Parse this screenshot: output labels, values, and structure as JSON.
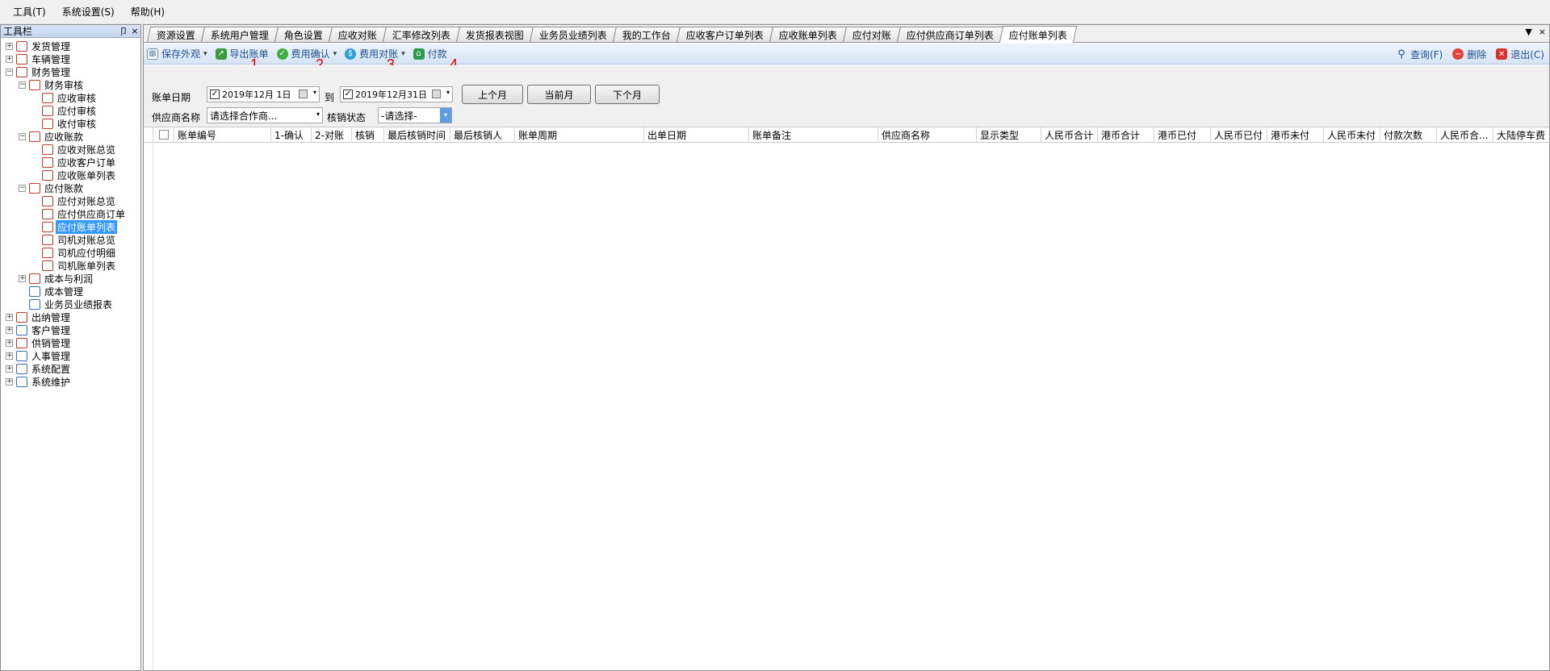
{
  "menu": [
    "工具(T)",
    "系统设置(S)",
    "帮助(H)"
  ],
  "sidebar": {
    "title": "工具栏",
    "pin": "卩",
    "close": "×",
    "tree": [
      {
        "label": "发货管理",
        "level": 0,
        "exp": "+",
        "icon": "document-icon"
      },
      {
        "label": "车辆管理",
        "level": 0,
        "exp": "+",
        "icon": "document-icon"
      },
      {
        "label": "财务管理",
        "level": 0,
        "exp": "−",
        "icon": "finance-icon"
      },
      {
        "label": "财务审核",
        "level": 1,
        "exp": "−",
        "icon": "audit-icon"
      },
      {
        "label": "应收审核",
        "level": 2,
        "exp": "",
        "icon": "yen-doc-icon"
      },
      {
        "label": "应付审核",
        "level": 2,
        "exp": "",
        "icon": "check-icon"
      },
      {
        "label": "收付审核",
        "level": 2,
        "exp": "",
        "icon": "pen-icon"
      },
      {
        "label": "应收账款",
        "level": 1,
        "exp": "−",
        "icon": "yen-doc-icon"
      },
      {
        "label": "应收对账总览",
        "level": 2,
        "exp": "",
        "icon": "doc-icon"
      },
      {
        "label": "应收客户订单",
        "level": 2,
        "exp": "",
        "icon": "doc-icon"
      },
      {
        "label": "应收账单列表",
        "level": 2,
        "exp": "",
        "icon": "doc-icon"
      },
      {
        "label": "应付账款",
        "level": 1,
        "exp": "−",
        "icon": "yen-doc-icon"
      },
      {
        "label": "应付对账总览",
        "level": 2,
        "exp": "",
        "icon": "yen-doc-icon"
      },
      {
        "label": "应付供应商订单",
        "level": 2,
        "exp": "",
        "icon": "doc-icon"
      },
      {
        "label": "应付账单列表",
        "level": 2,
        "exp": "",
        "icon": "truck-icon",
        "selected": true
      },
      {
        "label": "司机对账总览",
        "level": 2,
        "exp": "",
        "icon": "doc-icon"
      },
      {
        "label": "司机应付明细",
        "level": 2,
        "exp": "",
        "icon": "doc-icon"
      },
      {
        "label": "司机账单列表",
        "level": 2,
        "exp": "",
        "icon": "yen-doc-icon"
      },
      {
        "label": "成本与利润",
        "level": 1,
        "exp": "+",
        "icon": "chart-icon"
      },
      {
        "label": "成本管理",
        "level": 1,
        "exp": "",
        "icon": "people-icon"
      },
      {
        "label": "业务员业绩报表",
        "level": 1,
        "exp": "",
        "icon": "home-icon"
      },
      {
        "label": "出纳管理",
        "level": 0,
        "exp": "+",
        "icon": "yen-doc-icon"
      },
      {
        "label": "客户管理",
        "level": 0,
        "exp": "+",
        "icon": "people-icon"
      },
      {
        "label": "供销管理",
        "level": 0,
        "exp": "+",
        "icon": "cycle-icon"
      },
      {
        "label": "人事管理",
        "level": 0,
        "exp": "+",
        "icon": "people-icon"
      },
      {
        "label": "系统配置",
        "level": 0,
        "exp": "+",
        "icon": "gear-icon"
      },
      {
        "label": "系统维护",
        "level": 0,
        "exp": "+",
        "icon": "monitor-icon"
      }
    ]
  },
  "tabs": [
    "资源设置",
    "系统用户管理",
    "角色设置",
    "应收对账",
    "汇率修改列表",
    "发货报表视图",
    "业务员业绩列表",
    "我的工作台",
    "应收客户订单列表",
    "应收账单列表",
    "应付对账",
    "应付供应商订单列表",
    "应付账单列表"
  ],
  "active_tab": "应付账单列表",
  "tab_controls": {
    "dropdown": "▼",
    "close": "×"
  },
  "toolbar": {
    "save_layout": "保存外观",
    "export_bill": "导出账单",
    "fee_confirm": "费用确认",
    "fee_reconcile": "费用对账",
    "payment": "付款",
    "query": "查询(F)",
    "delete": "删除",
    "exit": "退出(C)",
    "dropdown_arrow": "▾"
  },
  "annotations": [
    "1",
    "2",
    "3",
    "4"
  ],
  "filters": {
    "bill_date_label": "账单日期",
    "date_from": "2019年12月 1日",
    "to_label": "到",
    "date_to": "2019年12月31日",
    "prev_month": "上个月",
    "current_month": "当前月",
    "next_month": "下个月",
    "supplier_label": "供应商名称",
    "supplier_placeholder": "请选择合作商...",
    "writeoff_label": "核销状态",
    "writeoff_value": "-请选择-",
    "check_mark": "✓"
  },
  "grid": {
    "columns": [
      "账单编号",
      "1-确认",
      "2-对账",
      "核销",
      "最后核销时间",
      "最后核销人",
      "账单周期",
      "出单日期",
      "账单备注",
      "供应商名称",
      "显示类型",
      "人民币合计",
      "港币合计",
      "港币已付",
      "人民币已付",
      "港币未付",
      "人民币未付",
      "付款次数",
      "人民币合...",
      "大陆停车费"
    ]
  }
}
